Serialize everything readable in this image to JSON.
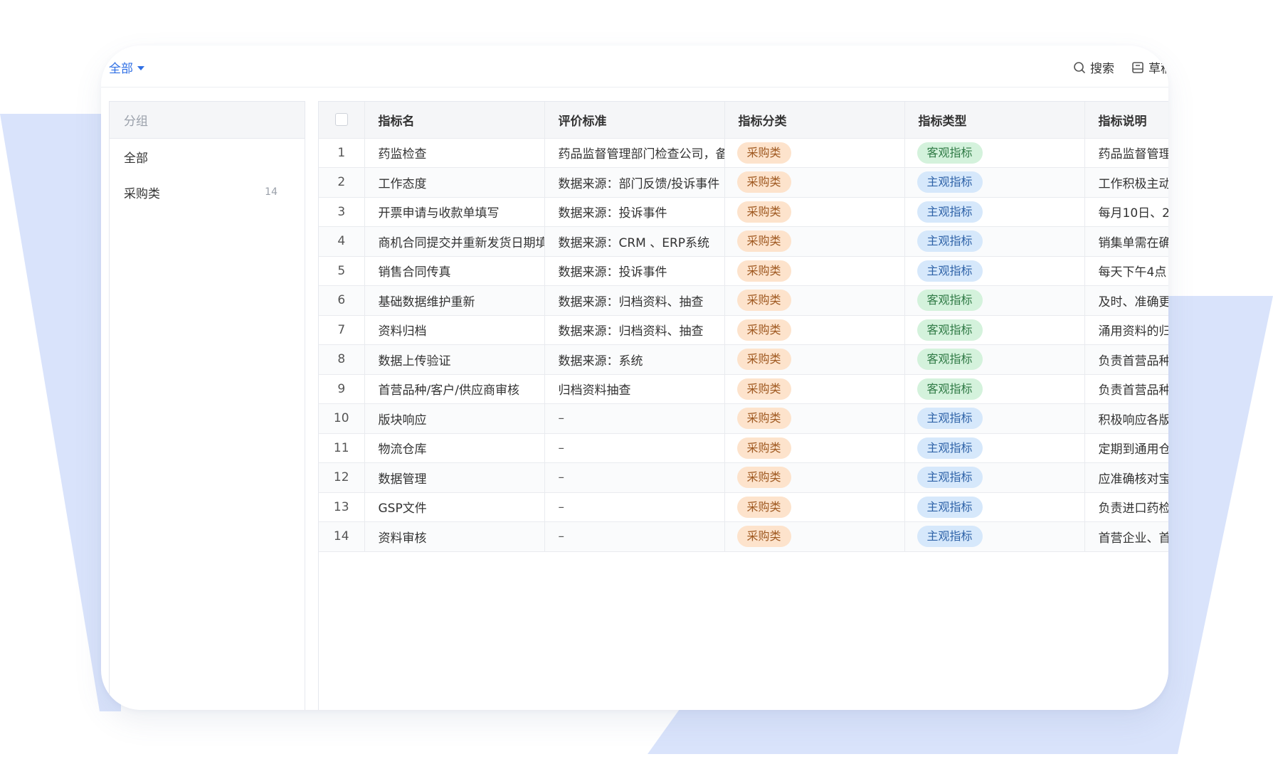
{
  "colors": {
    "accent": "#2f6fe4",
    "shape": "#d9e3fb"
  },
  "header": {
    "scope_label": "全部",
    "tools": [
      {
        "label": "搜索",
        "icon": "search-icon"
      },
      {
        "label": "草稿",
        "icon": "draft-icon"
      }
    ]
  },
  "sidebar": {
    "title": "分组",
    "items": [
      {
        "label": "全部",
        "count": ""
      },
      {
        "label": "采购类",
        "count": "14"
      }
    ]
  },
  "table": {
    "columns": [
      "指标名",
      "评价标准",
      "指标分类",
      "指标类型",
      "指标说明"
    ],
    "rows": [
      {
        "no": "1",
        "name": "药监检查",
        "standard": "药品监督管理部门检查公司，备",
        "category": "采购类",
        "type": "客观指标",
        "desc": "药品监督管理"
      },
      {
        "no": "2",
        "name": "工作态度",
        "standard": "数据来源：部门反馈/投诉事件",
        "category": "采购类",
        "type": "主观指标",
        "desc": "工作积极主动"
      },
      {
        "no": "3",
        "name": "开票申请与收款单填写",
        "standard": "数据来源：投诉事件",
        "category": "采购类",
        "type": "主观指标",
        "desc": "每月10日、2"
      },
      {
        "no": "4",
        "name": "商机合同提交并重新发货日期填写",
        "standard": "数据来源：CRM 、ERP系统",
        "category": "采购类",
        "type": "主观指标",
        "desc": "销集单需在确"
      },
      {
        "no": "5",
        "name": "销售合同传真",
        "standard": "数据来源：投诉事件",
        "category": "采购类",
        "type": "主观指标",
        "desc": "每天下午4点"
      },
      {
        "no": "6",
        "name": "基础数据维护重新",
        "standard": "数据来源：归档资料、抽查",
        "category": "采购类",
        "type": "客观指标",
        "desc": "及时、准确更"
      },
      {
        "no": "7",
        "name": "资料归档",
        "standard": "数据来源：归档资料、抽查",
        "category": "采购类",
        "type": "客观指标",
        "desc": "涌用资料的归"
      },
      {
        "no": "8",
        "name": "数据上传验证",
        "standard": "数据来源：系统",
        "category": "采购类",
        "type": "客观指标",
        "desc": "负责首营品种"
      },
      {
        "no": "9",
        "name": "首营品种/客户/供应商审核",
        "standard": "归档资料抽查",
        "category": "采购类",
        "type": "客观指标",
        "desc": "负责首营品种"
      },
      {
        "no": "10",
        "name": "版块响应",
        "standard": "–",
        "category": "采购类",
        "type": "主观指标",
        "desc": "积极响应各版"
      },
      {
        "no": "11",
        "name": "物流仓库",
        "standard": "–",
        "category": "采购类",
        "type": "主观指标",
        "desc": "定期到通用仓"
      },
      {
        "no": "12",
        "name": "数据管理",
        "standard": "–",
        "category": "采购类",
        "type": "主观指标",
        "desc": "应准确核对宝"
      },
      {
        "no": "13",
        "name": "GSP文件",
        "standard": "–",
        "category": "采购类",
        "type": "主观指标",
        "desc": "负责进口药检"
      },
      {
        "no": "14",
        "name": "资料审核",
        "standard": "–",
        "category": "采购类",
        "type": "主观指标",
        "desc": "首营企业、首"
      }
    ]
  }
}
